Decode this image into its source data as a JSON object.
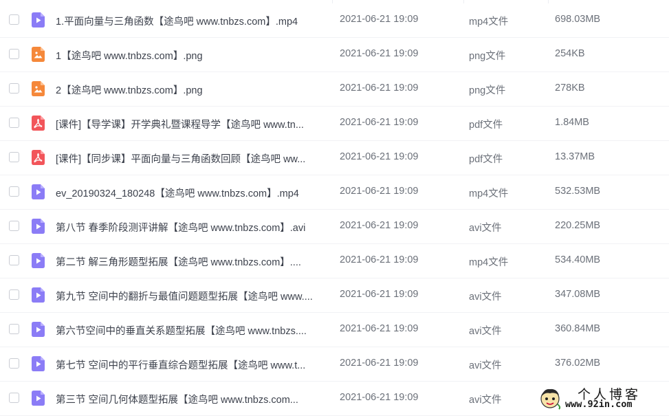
{
  "files": [
    {
      "icon": "video-icon",
      "name": "1.平面向量与三角函数【途鸟吧 www.tnbzs.com】.mp4",
      "date": "2021-06-21 19:09",
      "type": "mp4文件",
      "size": "698.03MB"
    },
    {
      "icon": "image-icon",
      "name": "1【途鸟吧 www.tnbzs.com】.png",
      "date": "2021-06-21 19:09",
      "type": "png文件",
      "size": "254KB"
    },
    {
      "icon": "image-icon",
      "name": "2【途鸟吧 www.tnbzs.com】.png",
      "date": "2021-06-21 19:09",
      "type": "png文件",
      "size": "278KB"
    },
    {
      "icon": "pdf-icon",
      "name": "[课件]【导学课】开学典礼暨课程导学【途鸟吧 www.tn...",
      "date": "2021-06-21 19:09",
      "type": "pdf文件",
      "size": "1.84MB"
    },
    {
      "icon": "pdf-icon",
      "name": "[课件]【同步课】平面向量与三角函数回顾【途鸟吧 ww...",
      "date": "2021-06-21 19:09",
      "type": "pdf文件",
      "size": "13.37MB"
    },
    {
      "icon": "video-icon",
      "name": "ev_20190324_180248【途鸟吧 www.tnbzs.com】.mp4",
      "date": "2021-06-21 19:09",
      "type": "mp4文件",
      "size": "532.53MB"
    },
    {
      "icon": "video-icon",
      "name": "第八节 春季阶段测评讲解【途鸟吧 www.tnbzs.com】.avi",
      "date": "2021-06-21 19:09",
      "type": "avi文件",
      "size": "220.25MB"
    },
    {
      "icon": "video-icon",
      "name": "第二节 解三角形题型拓展【途鸟吧 www.tnbzs.com】....",
      "date": "2021-06-21 19:09",
      "type": "mp4文件",
      "size": "534.40MB"
    },
    {
      "icon": "video-icon",
      "name": "第九节 空间中的翻折与最值问题题型拓展【途鸟吧 www....",
      "date": "2021-06-21 19:09",
      "type": "avi文件",
      "size": "347.08MB"
    },
    {
      "icon": "video-icon",
      "name": "第六节空间中的垂直关系题型拓展【途鸟吧 www.tnbzs....",
      "date": "2021-06-21 19:09",
      "type": "avi文件",
      "size": "360.84MB"
    },
    {
      "icon": "video-icon",
      "name": "第七节 空间中的平行垂直综合题型拓展【途鸟吧 www.t...",
      "date": "2021-06-21 19:09",
      "type": "avi文件",
      "size": "376.02MB"
    },
    {
      "icon": "video-icon",
      "name": "第三节 空间几何体题型拓展【途鸟吧 www.tnbzs.com...",
      "date": "2021-06-21 19:09",
      "type": "avi文件",
      "size": ""
    }
  ],
  "colors": {
    "video": "#8b7cf6",
    "image": "#f5883a",
    "pdf": "#f2555a"
  },
  "watermark": {
    "title": "个人博客",
    "url": "www.92in.com"
  }
}
